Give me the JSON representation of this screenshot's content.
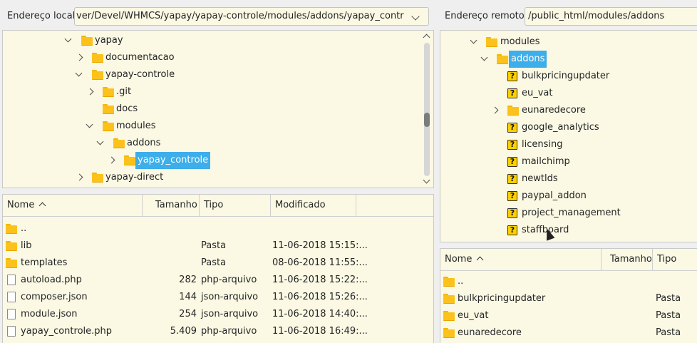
{
  "local": {
    "address_label": "Endereço local:",
    "address_value": "ver/Devel/WHMCS/yapay/yapay-controle/modules/addons/yapay_controle/",
    "tree": [
      {
        "label": "yapay",
        "expander": "down"
      },
      {
        "label": "documentacao",
        "expander": "right"
      },
      {
        "label": "yapay-controle",
        "expander": "down"
      },
      {
        "label": ".git",
        "expander": "right"
      },
      {
        "label": "docs",
        "expander": "none"
      },
      {
        "label": "modules",
        "expander": "down"
      },
      {
        "label": "addons",
        "expander": "down"
      },
      {
        "label": "yapay_controle",
        "expander": "right",
        "selected": true
      },
      {
        "label": "yapay-direct",
        "expander": "right"
      }
    ],
    "columns": {
      "name": "Nome",
      "size": "Tamanho",
      "type": "Tipo",
      "modified": "Modificado"
    },
    "files": [
      {
        "name": "..",
        "size": "",
        "type": "",
        "modified": "",
        "icon": "folder-icon"
      },
      {
        "name": "lib",
        "size": "",
        "type": "Pasta",
        "modified": "11-06-2018 15:15:...",
        "icon": "folder-icon"
      },
      {
        "name": "templates",
        "size": "",
        "type": "Pasta",
        "modified": "08-06-2018 11:55:...",
        "icon": "folder-icon"
      },
      {
        "name": "autoload.php",
        "size": "282",
        "type": "php-arquivo",
        "modified": "11-06-2018 15:22:...",
        "icon": "file-icon"
      },
      {
        "name": "composer.json",
        "size": "144",
        "type": "json-arquivo",
        "modified": "11-06-2018 15:26:...",
        "icon": "file-icon"
      },
      {
        "name": "module.json",
        "size": "254",
        "type": "json-arquivo",
        "modified": "11-06-2018 14:40:...",
        "icon": "file-icon"
      },
      {
        "name": "yapay_controle.php",
        "size": "5.409",
        "type": "php-arquivo",
        "modified": "11-06-2018 16:49:...",
        "icon": "file-icon"
      }
    ]
  },
  "remote": {
    "address_label": "Endereço remoto:",
    "address_value": "/public_html/modules/addons",
    "tree": [
      {
        "label": "modules",
        "expander": "down",
        "icon": "folder"
      },
      {
        "label": "addons",
        "expander": "down",
        "icon": "folder",
        "selected": true
      },
      {
        "label": "bulkpricingupdater",
        "expander": "none",
        "icon": "unknown"
      },
      {
        "label": "eu_vat",
        "expander": "none",
        "icon": "unknown"
      },
      {
        "label": "eunaredecore",
        "expander": "right",
        "icon": "folder"
      },
      {
        "label": "google_analytics",
        "expander": "none",
        "icon": "unknown"
      },
      {
        "label": "licensing",
        "expander": "none",
        "icon": "unknown"
      },
      {
        "label": "mailchimp",
        "expander": "none",
        "icon": "unknown"
      },
      {
        "label": "newtlds",
        "expander": "none",
        "icon": "unknown"
      },
      {
        "label": "paypal_addon",
        "expander": "none",
        "icon": "unknown"
      },
      {
        "label": "project_management",
        "expander": "none",
        "icon": "unknown"
      },
      {
        "label": "staffboard",
        "expander": "none",
        "icon": "unknown"
      }
    ],
    "columns": {
      "name": "Nome",
      "size": "Tamanho",
      "type": "Tipo"
    },
    "files": [
      {
        "name": "..",
        "type": ""
      },
      {
        "name": "bulkpricingupdater",
        "type": "Pasta"
      },
      {
        "name": "eu_vat",
        "type": "Pasta"
      },
      {
        "name": "eunaredecore",
        "type": "Pasta"
      }
    ]
  },
  "colors": {
    "selection": "#3daee9",
    "pane_background": "#fbf8e3",
    "folder": "#fcc21b"
  }
}
